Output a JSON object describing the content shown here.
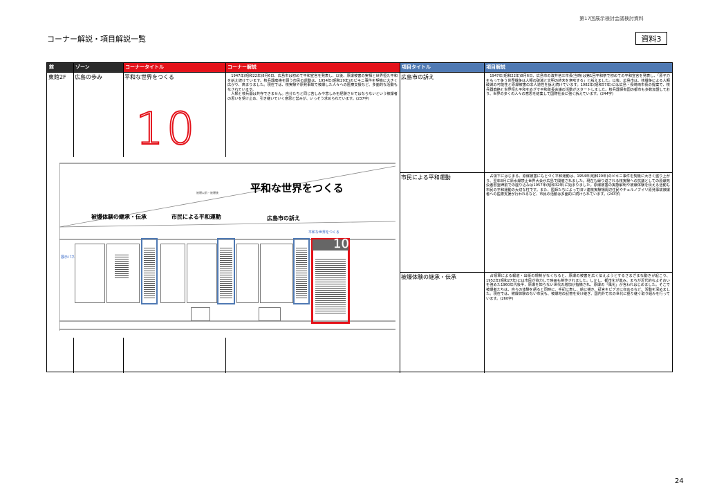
{
  "header": {
    "note": "第17回展示検討会議検討資料",
    "title": "コーナー解説・項目解説一覧",
    "badge": "資料3",
    "page_number": "24"
  },
  "table": {
    "headers": {
      "building": "館",
      "zone": "ゾーン",
      "corner_title": "コーナータイトル",
      "corner_desc": "コーナー解説",
      "item_title": "項目タイトル",
      "item_desc": "項目解説"
    },
    "building": "東館2F",
    "zone": "広島の歩み",
    "corner_title": "平和な世界をつくる",
    "corner_number": "10",
    "corner_desc": "　1947年(昭和22年)8月6日、広島市は初めて平和宣言を発表し、以後、原爆被害の実相と世界恒久平和を訴え続けています。核兵器廃絶を願う市民の運動は、1954年(昭和29年)のビキニ事件を契機に大きく広がり、高まりました。現在では、核実験や原発事故で被爆した人々への医療支援など、多面的な活動もなされています。\n　人類と核兵器は共存できません。自分たちと同じ苦しみや悲しみを経験させてはならないという被爆者の思いを受け止め、引き継いでいく意思と営みが、いっそう求められています。(237字)",
    "items": [
      {
        "title": "広島市の訴え",
        "desc": "　1947年(昭和22年)8月6日、広島市の濱井信三市長(当時)は第1回平和祭で初めての平和宣言を発表し、「原子力をもって争う世界戦争は人類の破滅と文明の終末を意味する」と訴えました。以後、広島市は、核戦争による人類破滅の可能性と原爆被害の非人道性を訴え続けています。1982年(昭和57年)には広島・長崎両市長の提案で、核兵器廃絶と世界恒久平和をめざす平和首長会議の活動がスタートしました。核兵器保有国の都市も多数加盟しており、世界の多くの人々の意思を結集して国際社会に強く訴えています。(244字)"
      },
      {
        "title": "市民による平和運動",
        "desc": "　占領下にはじまる、原爆被害にもとづく平和運動は、1954年(昭和29年)のビキニ事件を契機に大きく盛り上がり、翌年8月に原水爆禁止世界大会が広島で開催されました。現在も繰り返される核実験への抗議としての原爆死没者慰霊碑前での座り込みは1957年(昭和32年)に始まりました。原爆被害の実態解明や被爆体験を伝える活動も市民の平和運動の大切な柱です。また、医師たちによって旧ソ連核実験場周辺住民やチェルノブイリ原発事故被爆者への医療支援が行われるなど、市民の活動は多面的に続けられています。(243字)"
      },
      {
        "title": "被爆体験の継承・伝承",
        "desc": "　占領軍による報道・出版の規制がなくなると、原爆の被害を広く伝えようとするさまざまな動きが起こり、1952年(昭和27年)には市民が協力して映画も制作されました。しかし、都市化が進み、まちが近代的なよそおいを強めた1960年代後半、原爆を知らない世代の増加が指摘され、原爆の「風化」が言われはじめました。そこで被爆者たちは、自らの体験を語ると同時に、手記に表し、絵に描き、証言をビデオに収めるなど、活動を深めました。現在では、被爆体験のない市民も、被爆地の記憶を受け継ぎ、国内外で次の世代に語り継ぐ取り組みを行っています。(260字)"
      }
    ]
  },
  "panel": {
    "main_title": "平和な世界をつくる",
    "small_caption": "被爆以前・被爆後",
    "sub_inheritance": "被爆体験の継承・伝承",
    "sub_movement": "市民による平和運動",
    "sub_appeal": "広島市の訴え",
    "corner_label": "平和な世界をつくる",
    "left_label": "展示パネル",
    "corner_number": "10"
  },
  "colors": {
    "header_dark": "#2b2b2b",
    "header_red": "#e4121a",
    "header_blue": "#4f79b3",
    "accent_red": "#e4121a",
    "accent_blue": "#4f79b3"
  }
}
